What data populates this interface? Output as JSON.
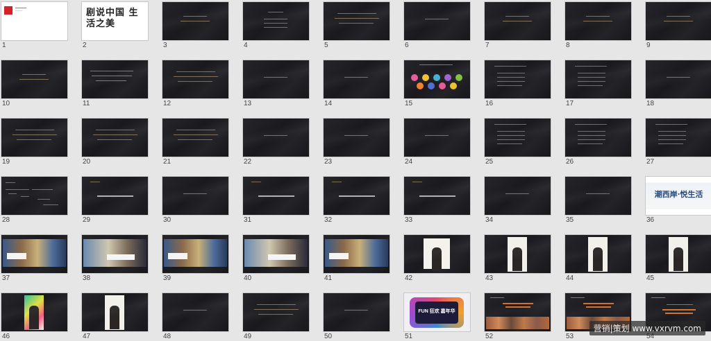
{
  "slides": [
    {
      "n": "1",
      "kind": "white-logo"
    },
    {
      "n": "2",
      "kind": "white-calligraphy"
    },
    {
      "n": "3",
      "kind": "dark-title"
    },
    {
      "n": "4",
      "kind": "dark-menu"
    },
    {
      "n": "5",
      "kind": "dark-text"
    },
    {
      "n": "6",
      "kind": "dark-short"
    },
    {
      "n": "7",
      "kind": "dark-title"
    },
    {
      "n": "8",
      "kind": "dark-title"
    },
    {
      "n": "9",
      "kind": "dark-title"
    },
    {
      "n": "10",
      "kind": "dark-title"
    },
    {
      "n": "11",
      "kind": "dark-text-white"
    },
    {
      "n": "12",
      "kind": "dark-text"
    },
    {
      "n": "13",
      "kind": "dark-short"
    },
    {
      "n": "14",
      "kind": "dark-short"
    },
    {
      "n": "15",
      "kind": "dark-dots"
    },
    {
      "n": "16",
      "kind": "dark-list"
    },
    {
      "n": "17",
      "kind": "dark-list"
    },
    {
      "n": "18",
      "kind": "dark-short"
    },
    {
      "n": "19",
      "kind": "dark-text"
    },
    {
      "n": "20",
      "kind": "dark-text"
    },
    {
      "n": "21",
      "kind": "dark-text"
    },
    {
      "n": "22",
      "kind": "dark-short"
    },
    {
      "n": "23",
      "kind": "dark-short"
    },
    {
      "n": "24",
      "kind": "dark-short"
    },
    {
      "n": "25",
      "kind": "dark-list"
    },
    {
      "n": "26",
      "kind": "dark-list"
    },
    {
      "n": "27",
      "kind": "dark-list"
    },
    {
      "n": "28",
      "kind": "dark-tree"
    },
    {
      "n": "29",
      "kind": "dark-title-white"
    },
    {
      "n": "30",
      "kind": "dark-short"
    },
    {
      "n": "31",
      "kind": "dark-title-white"
    },
    {
      "n": "32",
      "kind": "dark-title-white"
    },
    {
      "n": "33",
      "kind": "dark-title-white"
    },
    {
      "n": "34",
      "kind": "dark-short"
    },
    {
      "n": "35",
      "kind": "dark-short"
    },
    {
      "n": "36",
      "kind": "white-banner"
    },
    {
      "n": "37",
      "kind": "photo"
    },
    {
      "n": "38",
      "kind": "photo-alt"
    },
    {
      "n": "39",
      "kind": "photo"
    },
    {
      "n": "40",
      "kind": "photo-alt"
    },
    {
      "n": "41",
      "kind": "photo"
    },
    {
      "n": "42",
      "kind": "dark-poster-small"
    },
    {
      "n": "43",
      "kind": "dark-poster"
    },
    {
      "n": "44",
      "kind": "dark-poster"
    },
    {
      "n": "45",
      "kind": "dark-poster"
    },
    {
      "n": "46",
      "kind": "dark-poster-color"
    },
    {
      "n": "47",
      "kind": "dark-poster"
    },
    {
      "n": "48",
      "kind": "dark-short"
    },
    {
      "n": "49",
      "kind": "dark-text"
    },
    {
      "n": "50",
      "kind": "dark-short"
    },
    {
      "n": "51",
      "kind": "ring"
    },
    {
      "n": "52",
      "kind": "crowd"
    },
    {
      "n": "53",
      "kind": "crowd"
    },
    {
      "n": "54",
      "kind": "dark-red-text"
    }
  ],
  "calligraphy": "剧说中国 生活之美",
  "banner_text": "潮西岸·悦生活",
  "ring_text": "FUN 狂欢 嘉年华",
  "watermark": "营销|策划 www.vxrvm.com"
}
